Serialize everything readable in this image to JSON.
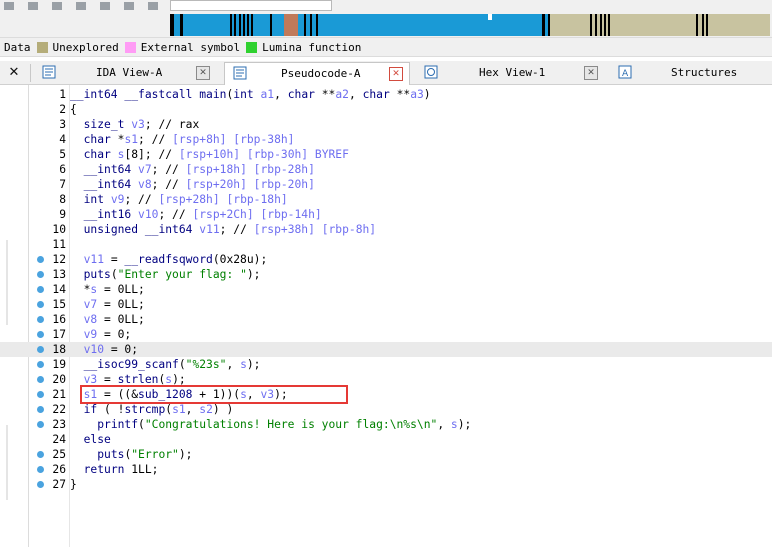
{
  "legend": {
    "items": [
      {
        "label": "Data",
        "color": null
      },
      {
        "label": "Unexplored",
        "color": "#b5ad7a"
      },
      {
        "label": "External symbol",
        "color": "#ff9cf5"
      },
      {
        "label": "Lumina function",
        "color": "#2fd12f"
      }
    ]
  },
  "tabs": [
    {
      "label": "IDA View-A",
      "icon": "ida-view-icon",
      "active": false
    },
    {
      "label": "Pseudocode-A",
      "icon": "pseudocode-icon",
      "active": true
    },
    {
      "label": "Hex View-1",
      "icon": "hex-view-icon",
      "active": false
    },
    {
      "label": "Structures",
      "icon": "structures-icon",
      "active": false
    }
  ],
  "code_lines": [
    {
      "n": "1",
      "dot": false,
      "text": "__int64 __fastcall main(int a1, char **a2, char **a3)"
    },
    {
      "n": "2",
      "dot": false,
      "text": "{"
    },
    {
      "n": "3",
      "dot": false,
      "text": "  size_t v3; // rax"
    },
    {
      "n": "4",
      "dot": false,
      "text": "  char *s1; // [rsp+8h] [rbp-38h]"
    },
    {
      "n": "5",
      "dot": false,
      "text": "  char s[8]; // [rsp+10h] [rbp-30h] BYREF"
    },
    {
      "n": "6",
      "dot": false,
      "text": "  __int64 v7; // [rsp+18h] [rbp-28h]"
    },
    {
      "n": "7",
      "dot": false,
      "text": "  __int64 v8; // [rsp+20h] [rbp-20h]"
    },
    {
      "n": "8",
      "dot": false,
      "text": "  int v9; // [rsp+28h] [rbp-18h]"
    },
    {
      "n": "9",
      "dot": false,
      "text": "  __int16 v10; // [rsp+2Ch] [rbp-14h]"
    },
    {
      "n": "10",
      "dot": false,
      "text": "  unsigned __int64 v11; // [rsp+38h] [rbp-8h]"
    },
    {
      "n": "11",
      "dot": false,
      "text": ""
    },
    {
      "n": "12",
      "dot": true,
      "text": "  v11 = __readfsqword(0x28u);"
    },
    {
      "n": "13",
      "dot": true,
      "text": "  puts(\"Enter your flag: \");"
    },
    {
      "n": "14",
      "dot": true,
      "text": "  *s = 0LL;"
    },
    {
      "n": "15",
      "dot": true,
      "text": "  v7 = 0LL;"
    },
    {
      "n": "16",
      "dot": true,
      "text": "  v8 = 0LL;"
    },
    {
      "n": "17",
      "dot": true,
      "text": "  v9 = 0;"
    },
    {
      "n": "18",
      "dot": true,
      "text": "  v10 = 0;"
    },
    {
      "n": "19",
      "dot": true,
      "text": "  __isoc99_scanf(\"%23s\", s);"
    },
    {
      "n": "20",
      "dot": true,
      "text": "  v3 = strlen(s);"
    },
    {
      "n": "21",
      "dot": true,
      "text": "  s1 = ((&sub_1208 + 1))(s, v3);"
    },
    {
      "n": "22",
      "dot": true,
      "text": "  if ( !strcmp(s1, s2) )"
    },
    {
      "n": "23",
      "dot": true,
      "text": "    printf(\"Congratulations! Here is your flag:\\n%s\\n\", s);"
    },
    {
      "n": "24",
      "dot": false,
      "text": "  else"
    },
    {
      "n": "25",
      "dot": true,
      "text": "    puts(\"Error\");"
    },
    {
      "n": "26",
      "dot": true,
      "text": "  return 1LL;"
    },
    {
      "n": "27",
      "dot": true,
      "text": "}"
    }
  ],
  "highlighted_line": "18",
  "boxed_line": "21"
}
